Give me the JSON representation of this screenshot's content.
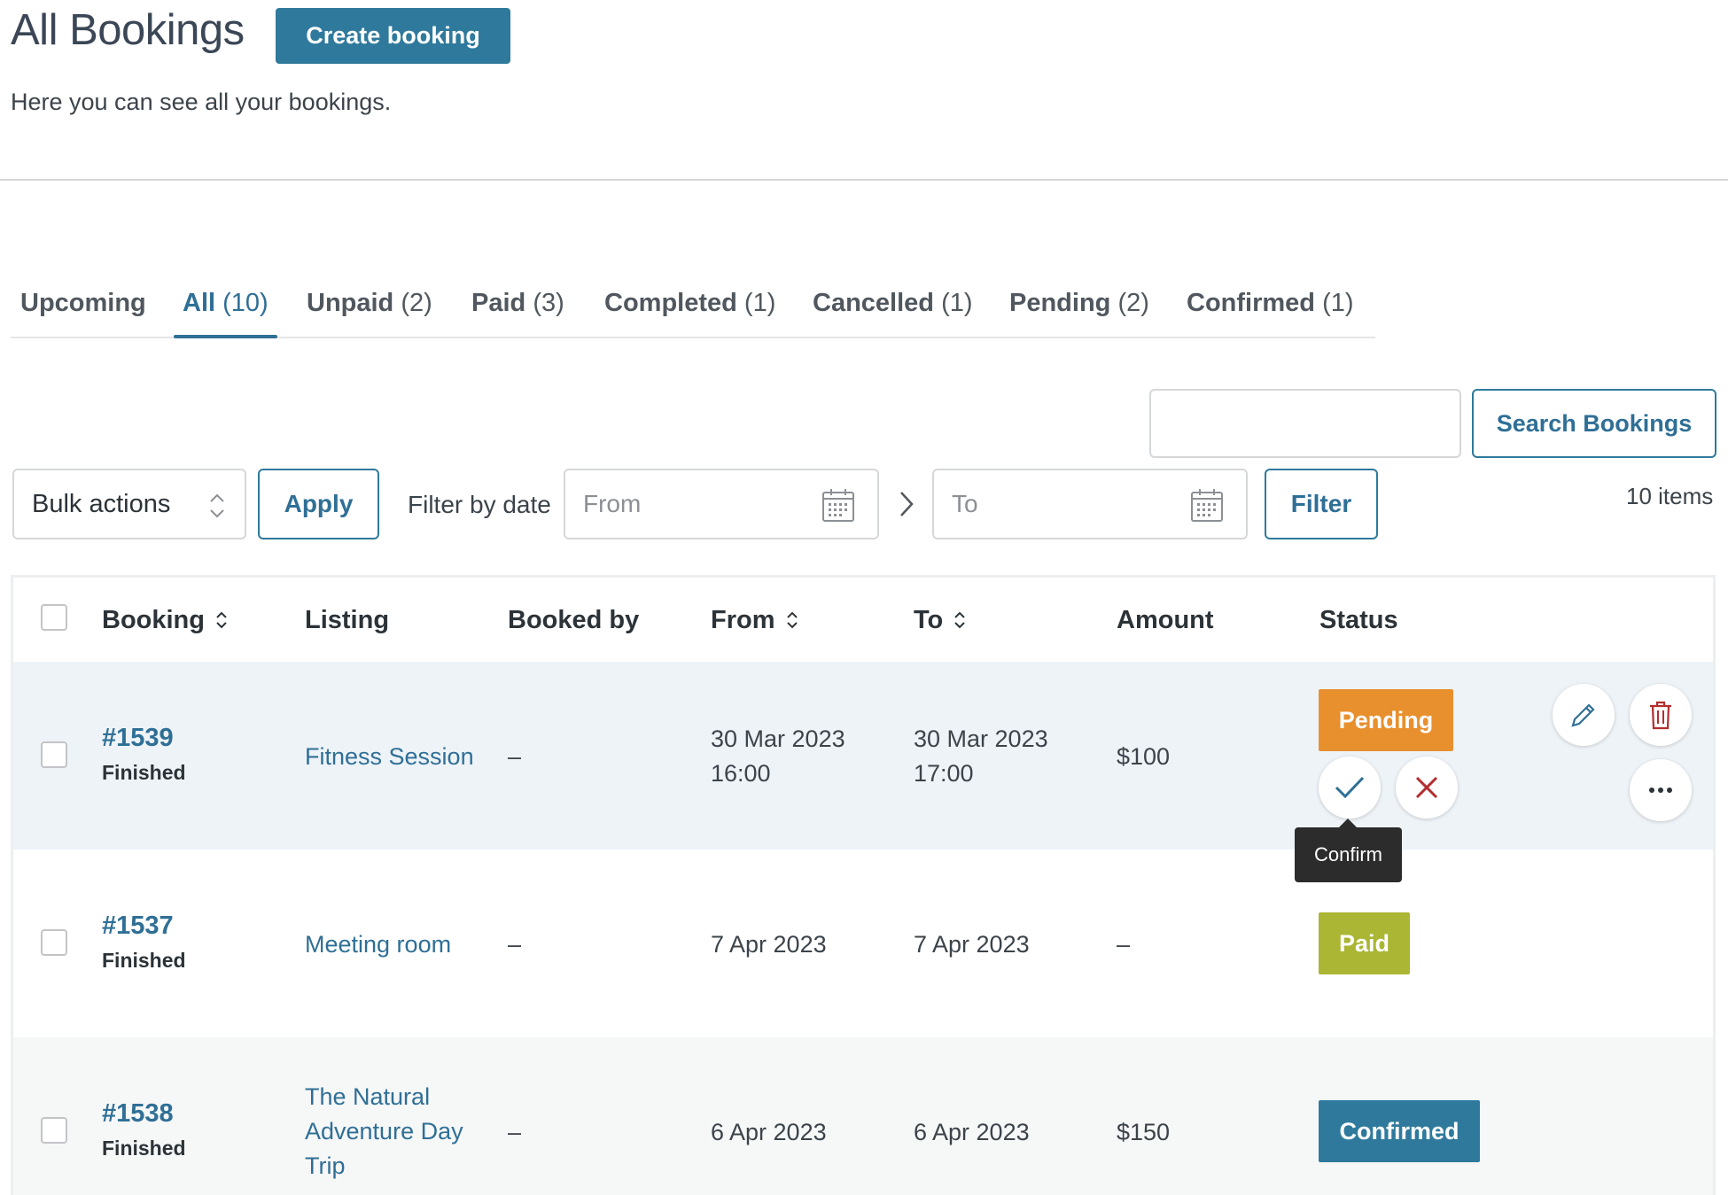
{
  "header": {
    "title": "All Bookings",
    "create_label": "Create booking",
    "subtitle": "Here you can see all your bookings."
  },
  "tabs": [
    {
      "label": "Upcoming",
      "count": ""
    },
    {
      "label": "All",
      "count": "(10)"
    },
    {
      "label": "Unpaid",
      "count": "(2)"
    },
    {
      "label": "Paid",
      "count": "(3)"
    },
    {
      "label": "Completed",
      "count": "(1)"
    },
    {
      "label": "Cancelled",
      "count": "(1)"
    },
    {
      "label": "Pending",
      "count": "(2)"
    },
    {
      "label": "Confirmed",
      "count": "(1)"
    }
  ],
  "search": {
    "value": "",
    "button_label": "Search Bookings"
  },
  "toolbar": {
    "bulk_label": "Bulk actions",
    "apply_label": "Apply",
    "filter_label": "Filter by date",
    "from_placeholder": "From",
    "to_placeholder": "To",
    "filter_button": "Filter",
    "items_count": "10 items"
  },
  "table": {
    "columns": [
      "Booking",
      "Listing",
      "Booked by",
      "From",
      "To",
      "Amount",
      "Status"
    ],
    "rows": [
      {
        "id": "#1539",
        "sub": "Finished",
        "listing": [
          "Fitness Session"
        ],
        "booked_by": "–",
        "from": [
          "30 Mar 2023",
          "16:00"
        ],
        "to": [
          "30 Mar 2023",
          "17:00"
        ],
        "amount": "$100",
        "status": "Pending"
      },
      {
        "id": "#1537",
        "sub": "Finished",
        "listing": [
          "Meeting room"
        ],
        "booked_by": "–",
        "from": [
          "7 Apr 2023"
        ],
        "to": [
          "7 Apr 2023"
        ],
        "amount": "–",
        "status": "Paid"
      },
      {
        "id": "#1538",
        "sub": "Finished",
        "listing": [
          "The Natural",
          "Adventure Day",
          "Trip"
        ],
        "booked_by": "–",
        "from": [
          "6 Apr 2023"
        ],
        "to": [
          "6 Apr 2023"
        ],
        "amount": "$150",
        "status": "Confirmed"
      }
    ]
  },
  "tooltip": "Confirm",
  "colors": {
    "primary": "#2f7a9c",
    "pending": "#e8902e",
    "paid": "#aab634",
    "confirmed": "#2f7a9c",
    "row_highlight": "#eef3f8"
  },
  "icons": [
    "chevron-updown-icon",
    "calendar-icon",
    "chevron-right-icon",
    "sort-icon",
    "pencil-icon",
    "trash-icon",
    "checkmark-icon",
    "close-icon",
    "more-icon"
  ]
}
